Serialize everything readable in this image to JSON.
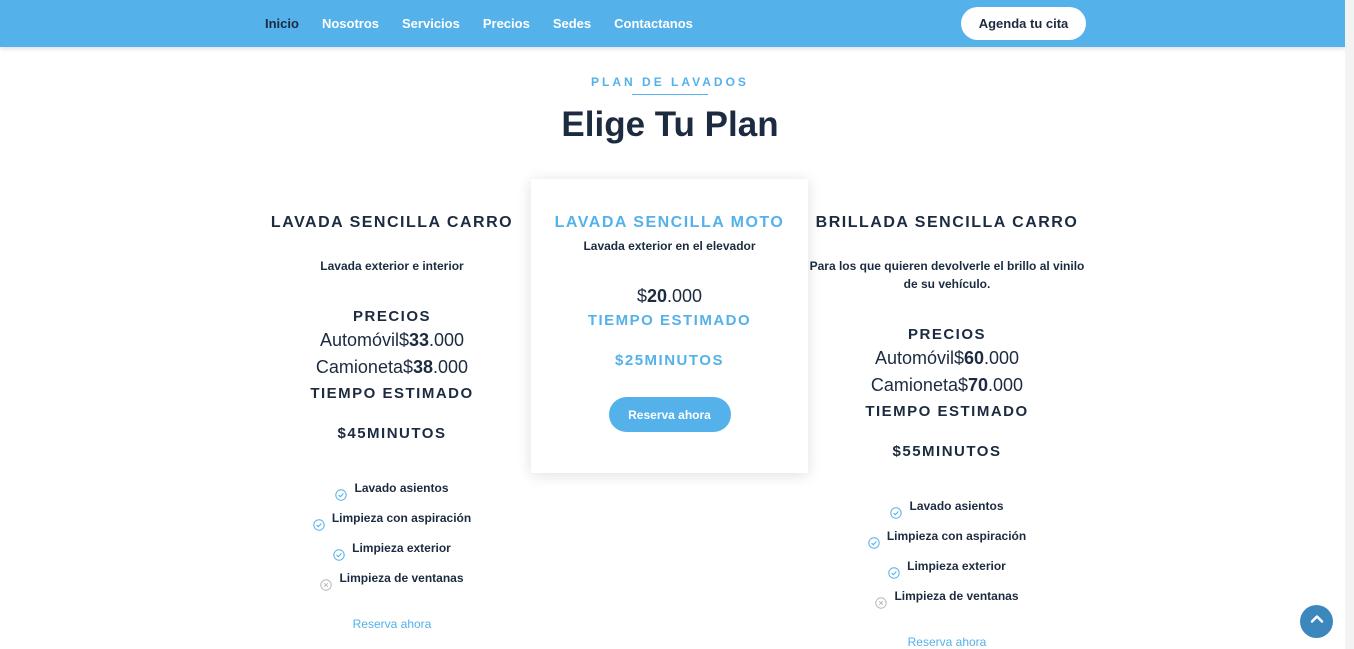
{
  "nav": {
    "links": [
      "Inicio",
      "Nosotros",
      "Servicios",
      "Precios",
      "Sedes",
      "Contactanos"
    ],
    "active": "Inicio",
    "cta_label": "Agenda tu cita"
  },
  "section": {
    "eyebrow": "PLAN DE LAVADOS",
    "title": "Elige Tu Plan"
  },
  "plans": [
    {
      "title": "LAVADA SENCILLA CARRO",
      "description": "Lavada exterior e interior",
      "prices_label": "PRECIOS",
      "prices": [
        {
          "label": "Automóvil$",
          "bold": "33",
          "rest": ".000"
        },
        {
          "label": "Camioneta$",
          "bold": "38",
          "rest": ".000"
        }
      ],
      "time_label": "TIEMPO ESTIMADO",
      "time_value": "$45MINUTOS",
      "features": [
        {
          "label": "Lavado asientos",
          "included": true
        },
        {
          "label": "Limpieza con aspiración",
          "included": true
        },
        {
          "label": "Limpieza exterior",
          "included": true
        },
        {
          "label": "Limpieza de ventanas",
          "included": false
        }
      ],
      "reserve_label": "Reserva ahora"
    },
    {
      "title": "LAVADA SENCILLA MOTO",
      "description": "Lavada exterior en el elevador",
      "price": {
        "label": "$",
        "bold": "20",
        "rest": ".000"
      },
      "time_label": "TIEMPO ESTIMADO",
      "time_value": "$25MINUTOS",
      "reserve_label": "Reserva ahora"
    },
    {
      "title": "BRILLADA SENCILLA CARRO",
      "description": "Para los que quieren devolverle el brillo al vinilo de su vehículo.",
      "prices_label": "PRECIOS",
      "prices": [
        {
          "label": "Automóvil$",
          "bold": "60",
          "rest": ".000"
        },
        {
          "label": "Camioneta$",
          "bold": "70",
          "rest": ".000"
        }
      ],
      "time_label": "TIEMPO ESTIMADO",
      "time_value": "$55MINUTOS",
      "features": [
        {
          "label": "Lavado asientos",
          "included": true
        },
        {
          "label": "Limpieza con aspiración",
          "included": true
        },
        {
          "label": "Limpieza exterior",
          "included": true
        },
        {
          "label": "Limpieza de ventanas",
          "included": false
        }
      ],
      "reserve_label": "Reserva ahora"
    }
  ],
  "icons": {
    "included": "check-circle-icon",
    "excluded": "x-circle-icon",
    "scroll_top": "chevron-up-icon"
  },
  "colors": {
    "accent": "#54b1ea",
    "dark": "#1c2b3f",
    "scroll_button": "#3c88bd"
  }
}
